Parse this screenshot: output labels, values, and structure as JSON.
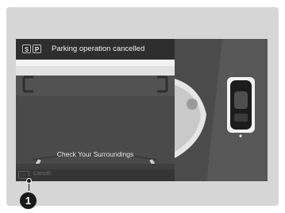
{
  "status": {
    "icon_left": "S",
    "icon_right": "P",
    "message": "Parking operation cancelled"
  },
  "camera": {
    "prompt": "Check Your Surroundings"
  },
  "bottom": {
    "cancel_icon_glyph": "...",
    "cancel_label": "Cancel"
  },
  "callout": {
    "number": "1"
  },
  "colors": {
    "screen_bg": "#3d3d3d",
    "frame_bg": "#d6d6d6",
    "guide_lines": "#cfcfcf"
  }
}
